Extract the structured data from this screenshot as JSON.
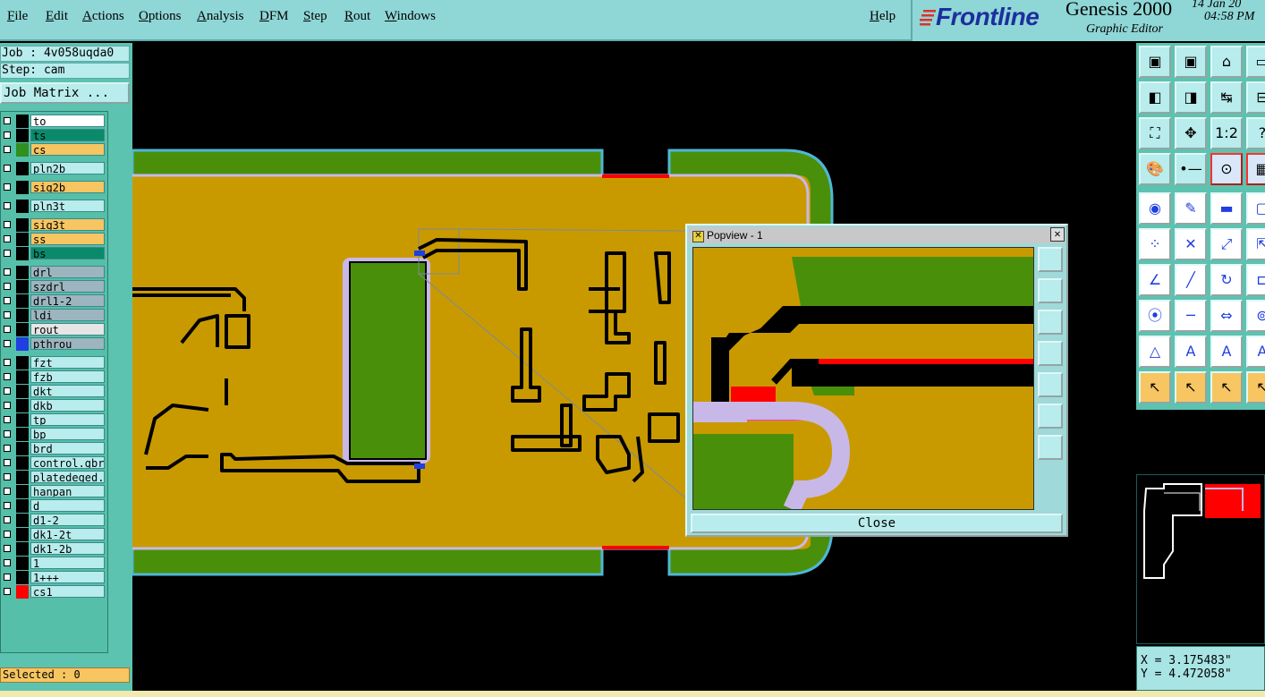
{
  "menu": {
    "items": [
      "File",
      "Edit",
      "Actions",
      "Options",
      "Analysis",
      "DFM",
      "Step",
      "Rout",
      "Windows"
    ],
    "help": "Help"
  },
  "brand": {
    "logo": "Frontline",
    "product": "Genesis 2000",
    "subtitle": "Graphic Editor",
    "date": "14 Jan 20",
    "time": "04:58 PM"
  },
  "job": {
    "job_label": "Job : 4v058uqda0",
    "step_label": "Step: cam",
    "matrix_button": "Job Matrix ..."
  },
  "layers": [
    {
      "name": "to",
      "color": "#ffffff",
      "swatch": "#000000"
    },
    {
      "name": "ts",
      "color": "#0a8a6a",
      "swatch": "#000000"
    },
    {
      "name": "cs",
      "color": "#f7c561",
      "swatch": "#2f8f1f"
    },
    {
      "name": "pln2b",
      "color": "#b9ecec",
      "swatch": "#000000"
    },
    {
      "name": "sig2b",
      "color": "#f7c561",
      "swatch": "#000000"
    },
    {
      "name": "pln3t",
      "color": "#b9ecec",
      "swatch": "#000000"
    },
    {
      "name": "sig3t",
      "color": "#f7c561",
      "swatch": "#000000"
    },
    {
      "name": "ss",
      "color": "#f7c561",
      "swatch": "#000000"
    },
    {
      "name": "bs",
      "color": "#0a8a6a",
      "swatch": "#000000"
    },
    {
      "name": "drl",
      "color": "#9db5bf",
      "swatch": "#000000"
    },
    {
      "name": "szdrl",
      "color": "#9db5bf",
      "swatch": "#000000"
    },
    {
      "name": "drl1-2",
      "color": "#9db5bf",
      "swatch": "#000000"
    },
    {
      "name": "ldi",
      "color": "#9db5bf",
      "swatch": "#000000"
    },
    {
      "name": "rout",
      "color": "#e6e6e6",
      "swatch": "#000000"
    },
    {
      "name": "pthrou",
      "color": "#9db5bf",
      "swatch": "#1f3fe0"
    },
    {
      "name": "fzt",
      "color": "#b9ecec",
      "swatch": "#000000"
    },
    {
      "name": "fzb",
      "color": "#b9ecec",
      "swatch": "#000000"
    },
    {
      "name": "dkt",
      "color": "#b9ecec",
      "swatch": "#000000"
    },
    {
      "name": "dkb",
      "color": "#b9ecec",
      "swatch": "#000000"
    },
    {
      "name": "tp",
      "color": "#b9ecec",
      "swatch": "#000000"
    },
    {
      "name": "bp",
      "color": "#b9ecec",
      "swatch": "#000000"
    },
    {
      "name": "brd",
      "color": "#b9ecec",
      "swatch": "#000000"
    },
    {
      "name": "control.gbr",
      "color": "#b9ecec",
      "swatch": "#000000"
    },
    {
      "name": "platedeged.g",
      "color": "#b9ecec",
      "swatch": "#000000"
    },
    {
      "name": "hanpan",
      "color": "#b9ecec",
      "swatch": "#000000"
    },
    {
      "name": "d",
      "color": "#b9ecec",
      "swatch": "#000000"
    },
    {
      "name": "d1-2",
      "color": "#b9ecec",
      "swatch": "#000000"
    },
    {
      "name": "dk1-2t",
      "color": "#b9ecec",
      "swatch": "#000000"
    },
    {
      "name": "dk1-2b",
      "color": "#b9ecec",
      "swatch": "#000000"
    },
    {
      "name": "1",
      "color": "#b9ecec",
      "swatch": "#000000"
    },
    {
      "name": "1+++",
      "color": "#b9ecec",
      "swatch": "#000000"
    },
    {
      "name": "cs1",
      "color": "#b9ecec",
      "swatch": "#ff0000"
    }
  ],
  "selected": "Selected : 0",
  "popview": {
    "title": "Popview - 1",
    "close_label": "Close"
  },
  "coords": {
    "x": "X = 3.175483\"",
    "y": "Y = 4.472058\""
  },
  "colors": {
    "board": "#c99a00",
    "copper_green": "#4a8f0a",
    "menu_bg": "#8fd6d6",
    "panel_bg": "#5cc3b0",
    "highlight": "#ff0000",
    "outline": "#c8b8e8"
  }
}
